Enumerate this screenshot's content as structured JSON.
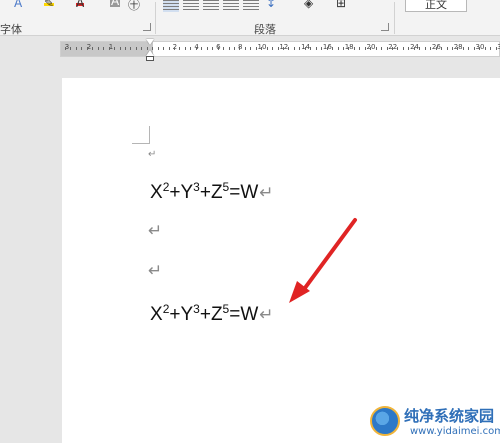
{
  "ribbon": {
    "font_group_label": "字体",
    "paragraph_group_label": "段落",
    "style_preview": "正文",
    "icons": [
      "text-effects-icon",
      "highlight-icon",
      "font-color-icon",
      "char-shading-icon",
      "enclose-char-icon",
      "align-left-icon",
      "align-center-icon",
      "align-right-icon",
      "justify-icon",
      "distributed-icon",
      "line-spacing-icon",
      "shading-icon",
      "borders-icon"
    ]
  },
  "ruler": {
    "numbers_left": [
      "3",
      "2",
      "1"
    ],
    "numbers_right": [
      "2",
      "4",
      "6",
      "8",
      "10",
      "12",
      "14",
      "16",
      "18",
      "20",
      "22",
      "24",
      "26",
      "28",
      "30",
      "32"
    ]
  },
  "document": {
    "paragraph_mark": "↵",
    "formulas": [
      {
        "parts": [
          "X",
          "2",
          "+Y",
          "3",
          "+Z",
          "5",
          "=W"
        ]
      },
      {
        "parts": [
          "X",
          "2",
          "+Y",
          "3",
          "+Z",
          "5",
          "=W"
        ]
      }
    ]
  },
  "annotation": {
    "arrow_color": "#e02424"
  },
  "watermark": {
    "title": "纯净系统家园",
    "url": "www.yidaimei.com"
  }
}
